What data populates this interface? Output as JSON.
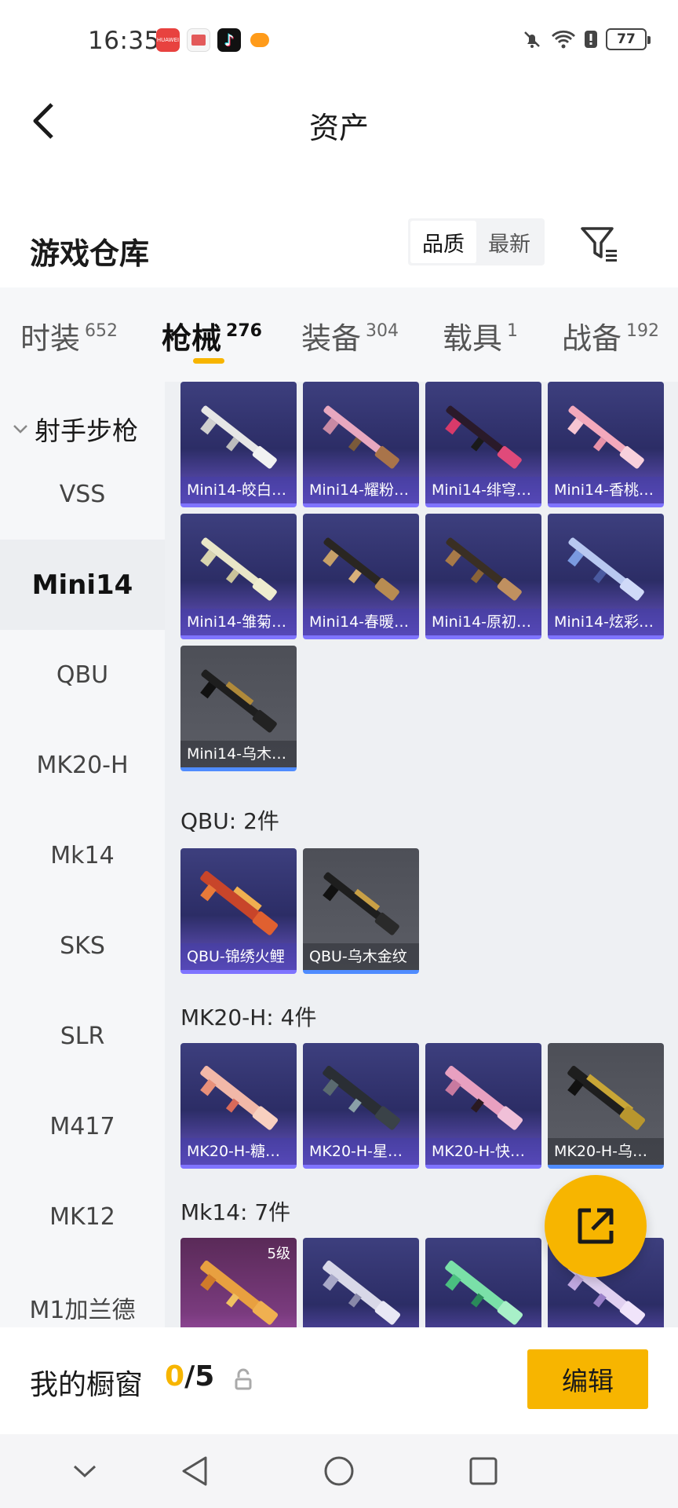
{
  "status_bar": {
    "time": "16:35",
    "apps": [
      {
        "icon": "huawei-app-icon",
        "label": "HUAWEI"
      },
      {
        "icon": "store-app-icon"
      },
      {
        "icon": "tiktok-app-icon"
      },
      {
        "icon": "game-app-icon"
      }
    ],
    "system_icons": [
      "mute-icon",
      "wifi-icon",
      "alert-icon"
    ],
    "battery": "77"
  },
  "header": {
    "title": "资产",
    "back_icon": "back-arrow-icon"
  },
  "warehouse": {
    "title": "游戏仓库",
    "sort_options": [
      "品质",
      "最新"
    ],
    "sort_selected": "品质",
    "filter_icon": "filter-icon"
  },
  "tabs": [
    {
      "label": "时装",
      "count": "652"
    },
    {
      "label": "枪械",
      "count": "276",
      "active": true
    },
    {
      "label": "装备",
      "count": "304"
    },
    {
      "label": "载具",
      "count": "1"
    },
    {
      "label": "战备",
      "count": "192"
    }
  ],
  "sidebar": {
    "group": "射手步枪",
    "items": [
      "VSS",
      "Mini14",
      "QBU",
      "MK20-H",
      "Mk14",
      "SKS",
      "SLR",
      "M417",
      "MK12",
      "M1加兰德"
    ],
    "active": "Mini14"
  },
  "sections": [
    {
      "label": "",
      "items": [
        "Mini14-皎白…",
        "Mini14-耀粉…",
        "Mini14-绯穹…",
        "Mini14-香桃…",
        "Mini14-雏菊…",
        "Mini14-春暖…",
        "Mini14-原初…",
        "Mini14-炫彩…",
        "Mini14-乌木…"
      ]
    },
    {
      "label": "QBU: 2件",
      "items": [
        "QBU-锦绣火鲤",
        "QBU-乌木金纹"
      ]
    },
    {
      "label": "MK20-H: 4件",
      "items": [
        "MK20-H-糖…",
        "MK20-H-星…",
        "MK20-H-快…",
        "MK20-H-乌…"
      ]
    },
    {
      "label": "Mk14: 7件",
      "items": [],
      "first_level": "5级"
    }
  ],
  "fab_icon": "share-icon",
  "showcase": {
    "label": "我的橱窗",
    "current": "0",
    "total": "/5",
    "lock_icon": "lock-icon",
    "edit_label": "编辑"
  },
  "system_nav": [
    "chevron-down-icon",
    "back-triangle-icon",
    "home-circle-icon",
    "recents-square-icon"
  ],
  "colors": {
    "accent": "#f7b500",
    "card_purple": "#3d3f7e",
    "card_grey": "#55575f"
  }
}
